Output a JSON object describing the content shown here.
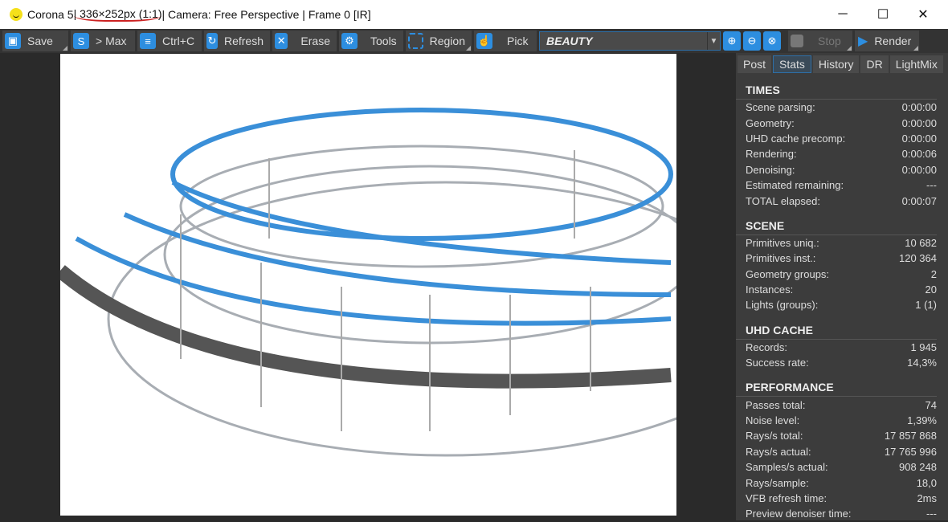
{
  "title": {
    "app": "Corona 5 ",
    "sep1": "|",
    "resolution": " 336×252px (1:1)",
    "rest": " | Camera: Free Perspective | Frame 0 [IR]"
  },
  "window": {
    "minimize": "─",
    "maximize": "☐",
    "close": "✕"
  },
  "toolbar": {
    "save": "Save",
    "max": "> Max",
    "copy": "Ctrl+C",
    "refresh": "Refresh",
    "erase": "Erase",
    "tools": "Tools",
    "region": "Region",
    "pick": "Pick",
    "channel": "BEAUTY",
    "stop": "Stop",
    "render": "Render"
  },
  "tabs": [
    "Post",
    "Stats",
    "History",
    "DR",
    "LightMix"
  ],
  "sections": [
    {
      "title": "TIMES",
      "rows": [
        [
          "Scene parsing:",
          "0:00:00"
        ],
        [
          "Geometry:",
          "0:00:00"
        ],
        [
          "UHD cache precomp:",
          "0:00:00"
        ],
        [
          "Rendering:",
          "0:00:06"
        ],
        [
          "Denoising:",
          "0:00:00"
        ],
        [
          "Estimated remaining:",
          "---"
        ],
        [
          "TOTAL elapsed:",
          "0:00:07"
        ]
      ]
    },
    {
      "title": "SCENE",
      "rows": [
        [
          "Primitives uniq.:",
          "10 682"
        ],
        [
          "Primitives inst.:",
          "120 364"
        ],
        [
          "Geometry groups:",
          "2"
        ],
        [
          "Instances:",
          "20"
        ],
        [
          "Lights (groups):",
          "1 (1)"
        ]
      ]
    },
    {
      "title": "UHD CACHE",
      "rows": [
        [
          "Records:",
          "1 945"
        ],
        [
          "Success rate:",
          "14,3%"
        ]
      ]
    },
    {
      "title": "PERFORMANCE",
      "rows": [
        [
          "Passes total:",
          "74"
        ],
        [
          "Noise level:",
          "1,39%"
        ],
        [
          "Rays/s total:",
          "17 857 868"
        ],
        [
          "Rays/s actual:",
          "17 765 996"
        ],
        [
          "Samples/s actual:",
          "908 248"
        ],
        [
          "Rays/sample:",
          "18,0"
        ],
        [
          "VFB refresh time:",
          "2ms"
        ],
        [
          "Preview denoiser time:",
          "---"
        ]
      ]
    }
  ]
}
